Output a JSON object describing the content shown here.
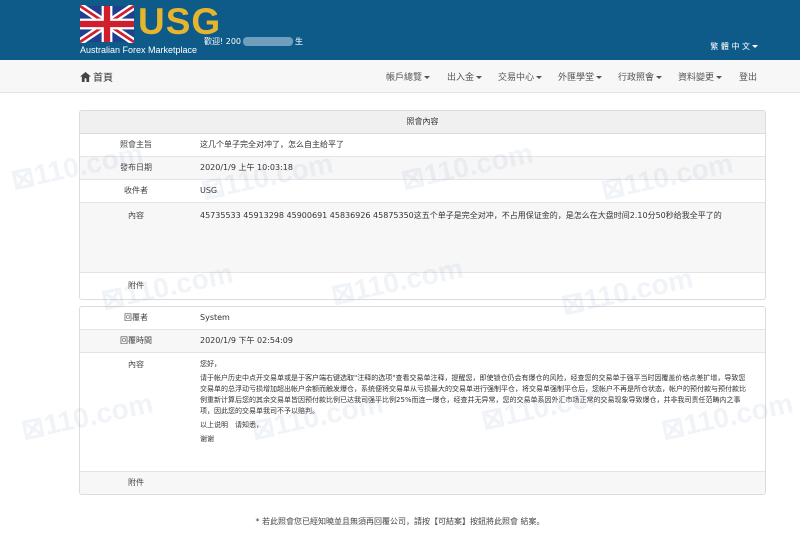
{
  "header": {
    "logo": "USG",
    "logo_sub": "Australian Forex Marketplace",
    "welcome": "歡迎! 200",
    "welcome_suffix": "生",
    "lang": "繁 體 中 文"
  },
  "nav": {
    "home": "首頁",
    "items": [
      "帳戶總覽",
      "出入金",
      "交易中心",
      "外匯學堂",
      "行政照會",
      "資料變更"
    ],
    "logout": "登出"
  },
  "notice": {
    "title": "照會內容",
    "subject_label": "照會主旨",
    "subject": "这几个单子完全对冲了，怎么自主给平了",
    "date_label": "發布日期",
    "date": "2020/1/9 上午 10:03:18",
    "recipient_label": "收件者",
    "recipient": "USG",
    "content_label": "內容",
    "content": "45735533 45913298 45900691 45836926 45875350这五个单子是完全对冲，不占用保证金的，是怎么在大盘时间2.10分50秒给我全平了的",
    "attach_label": "附件"
  },
  "reply": {
    "replier_label": "回覆者",
    "replier": "System",
    "time_label": "回覆時間",
    "time": "2020/1/9 下午 02:54:09",
    "content_label": "內容",
    "greeting": "您好，",
    "body": "请于帐户历史中点开交易单或是于客户端右键选取\"注释的选项\"查看交易单注释，提醒您，即使锁仓仍会有爆仓的风险，经查您的交易单于强平当时因覆盖价格点差扩增，导致您交易单的总浮动亏损增加超出帐户余额而触发爆仓，系统便将交易单从亏损最大的交易单进行强制平仓，将交易单强制平仓后，您帐户不再是所仓状态，帐户的预付款与预付款比例重新计算后您的其余交易单皆因预付款比例已达我司强平比例25%而连一爆仓，经查并无异常，您的交易单系因外汇市场正常的交易现象导致爆仓，并非我司责任范畴内之事项，因此您的交易单我司不予以赔判。",
    "closing1": "以上说明　请知悉，",
    "closing2": "谢谢",
    "attach_label": "附件"
  },
  "footer": "* 若此照會您已經知曉並且無須再回覆公司，請按【可結案】按鈕將此照會 結案。"
}
